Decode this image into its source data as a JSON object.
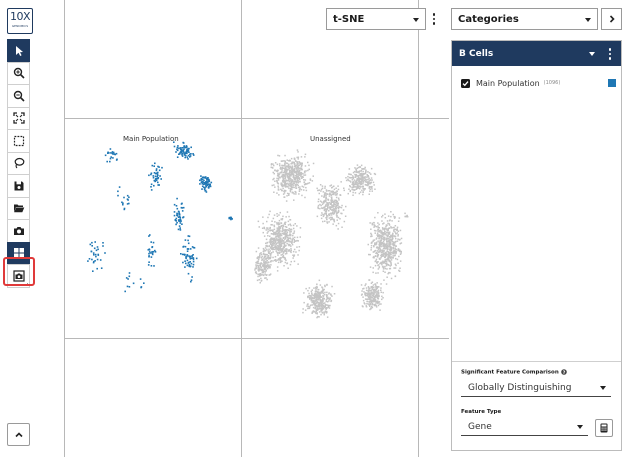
{
  "logo": {
    "big": "10X",
    "small": "GENOMICS"
  },
  "toolbar": {
    "tools": [
      {
        "id": "pointer",
        "icon": "pointer-icon"
      },
      {
        "id": "zoom-in",
        "icon": "zoom-in-icon"
      },
      {
        "id": "zoom-out",
        "icon": "zoom-out-icon"
      },
      {
        "id": "fit",
        "icon": "fit-to-screen-icon"
      },
      {
        "id": "box-select",
        "icon": "box-select-icon"
      },
      {
        "id": "lasso",
        "icon": "lasso-icon"
      },
      {
        "id": "save",
        "icon": "save-icon"
      },
      {
        "id": "open",
        "icon": "folder-open-icon"
      },
      {
        "id": "screenshot",
        "icon": "camera-icon"
      },
      {
        "id": "split-view",
        "icon": "grid-icon"
      },
      {
        "id": "snapshot",
        "icon": "camera-frame-icon"
      }
    ],
    "collapse_icon": "chevron-up-icon"
  },
  "projection": {
    "selected": "t-SNE"
  },
  "plots": {
    "left_label": "Main Population",
    "right_label": "Unassigned",
    "main_color": "#1f77b4",
    "unassigned_color": "#c4c4c4"
  },
  "panel": {
    "category_selector": "Categories",
    "title": "B Cells",
    "categories": [
      {
        "label": "Main Population",
        "count": "(1096)",
        "color": "#1f77b4"
      }
    ],
    "comparison": {
      "title": "Significant Feature Comparison",
      "value": "Globally Distinguishing"
    },
    "feature_type": {
      "title": "Feature Type",
      "value": "Gene"
    }
  }
}
